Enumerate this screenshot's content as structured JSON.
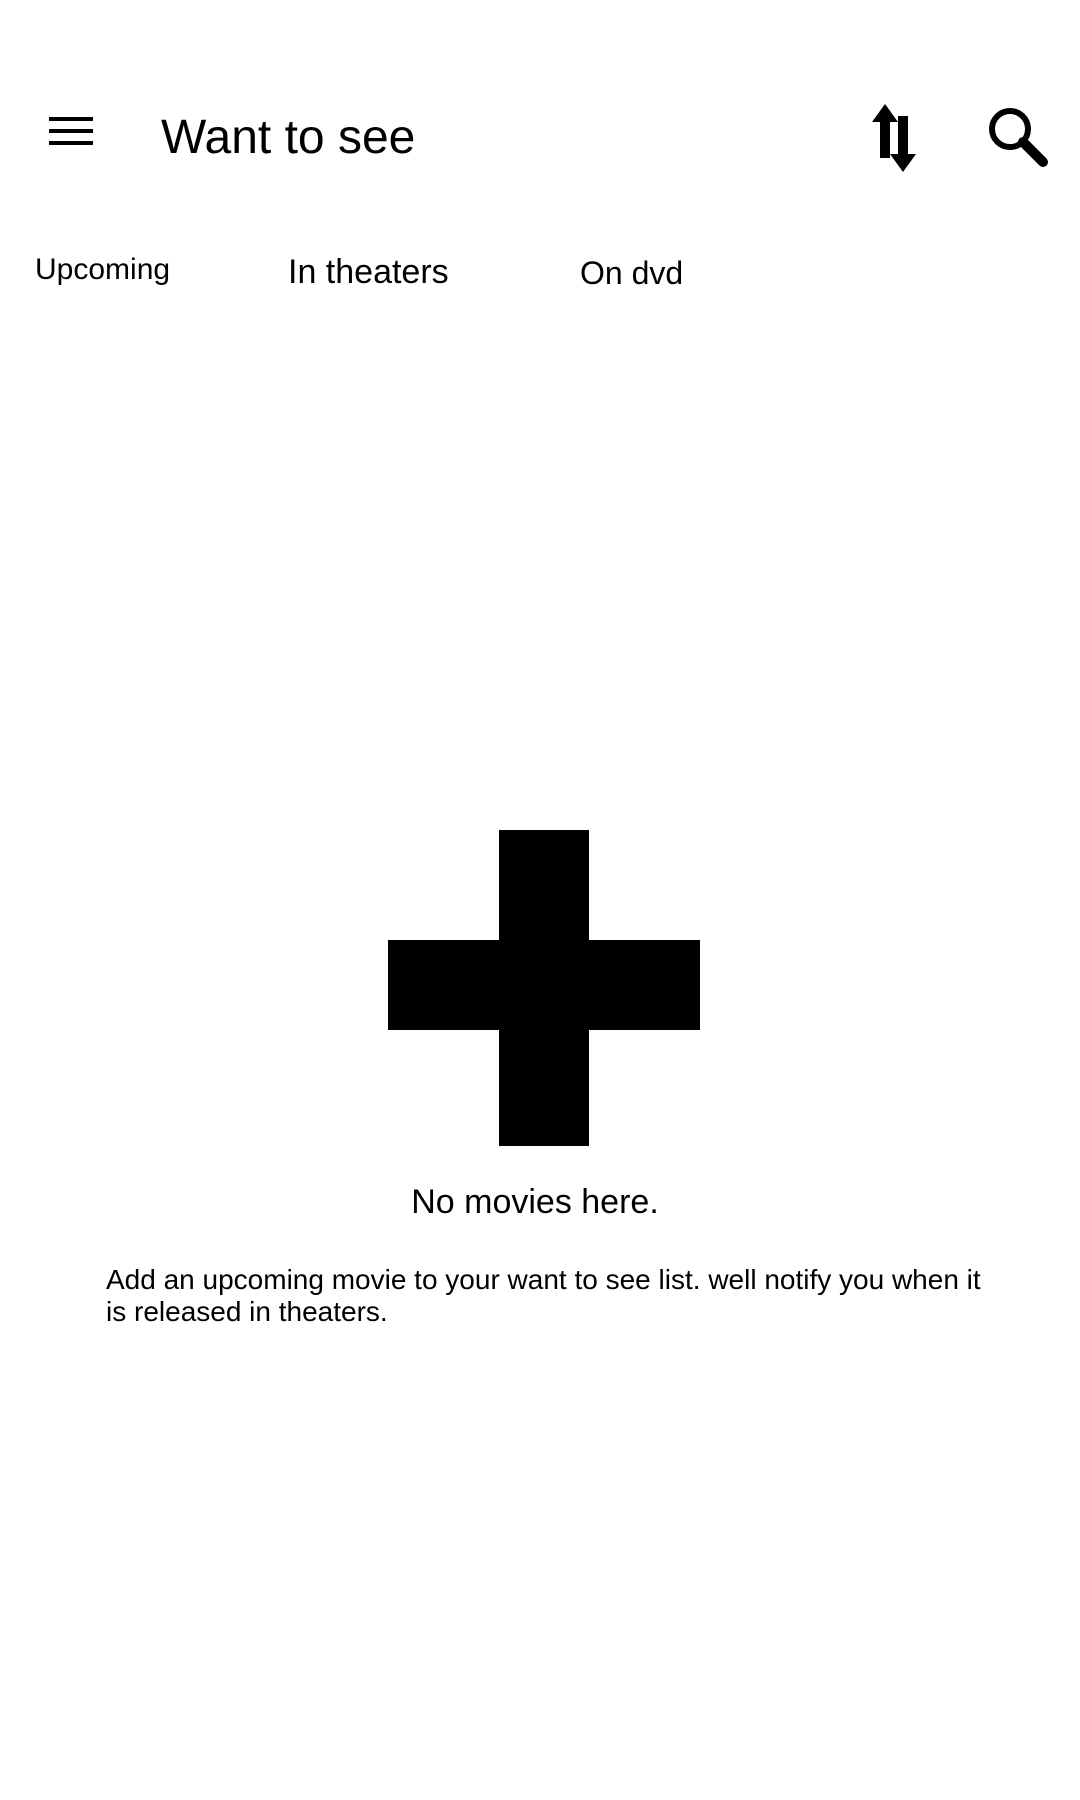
{
  "app_bar": {
    "menu_icon": "hamburger-menu-icon",
    "title": "Want to see",
    "sort_icon": "sort-arrows-icon",
    "search_icon": "search-icon"
  },
  "tabs": [
    {
      "label": "Upcoming"
    },
    {
      "label": "In theaters"
    },
    {
      "label": "On dvd"
    }
  ],
  "empty_state": {
    "icon": "add-plus-icon",
    "title": "No movies here.",
    "message": "Add an upcoming movie to your want to see list. well notify you when it is released in theaters."
  },
  "colors": {
    "background": "#ffffff",
    "foreground": "#000000"
  }
}
